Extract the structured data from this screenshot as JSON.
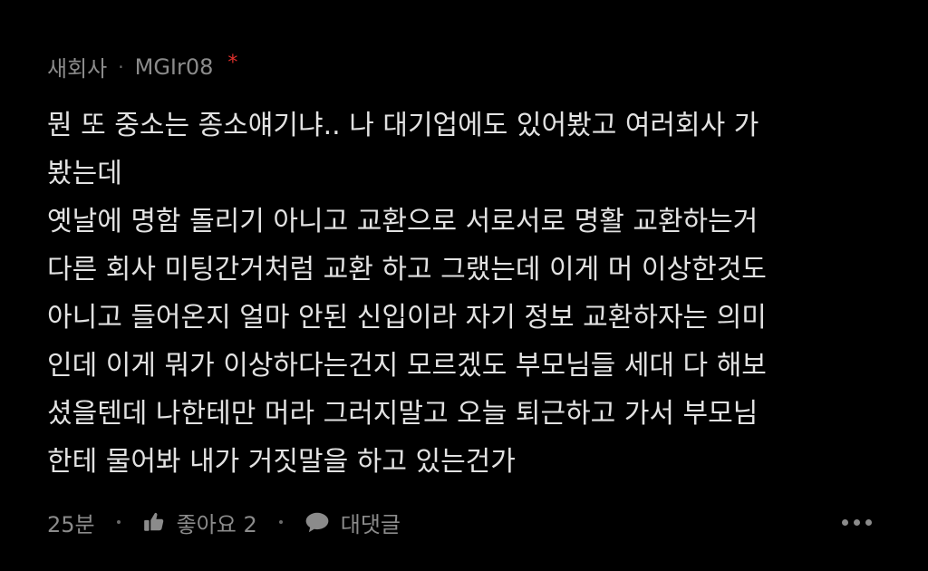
{
  "comment": {
    "company": "새회사",
    "separator": "·",
    "author": "MGIr08",
    "badge": "*",
    "text": "뭔 또 중소는 종소얘기냐.. 나 대기업에도 있어봤고 여러회사 가\n봤는데\n옛날에 명함 돌리기 아니고 교환으로 서로서로 명활 교환하는거\n다른 회사 미팅간거처럼 교환 하고 그랬는데 이게 머 이상한것도\n아니고 들어온지 얼마 안된 신입이라 자기 정보 교환하자는 의미\n인데 이게 뭐가 이상하다는건지 모르겠도 부모님들 세대 다 해보\n셨을텐데 나한테만 머라 그러지말고 오늘 퇴근하고 가서 부모님\n한테 물어봐 내가 거짓말을 하고 있는건가",
    "time": "25분",
    "like_label": "좋아요 2",
    "reply_label": "대댓글",
    "icons": {
      "like": "thumbs-up-icon",
      "reply": "speech-bubble-icon",
      "more": "more-options-icon"
    },
    "colors": {
      "background": "#000000",
      "text": "#e2e2e2",
      "meta": "#8b8b8b",
      "badge": "#e0302c"
    }
  }
}
